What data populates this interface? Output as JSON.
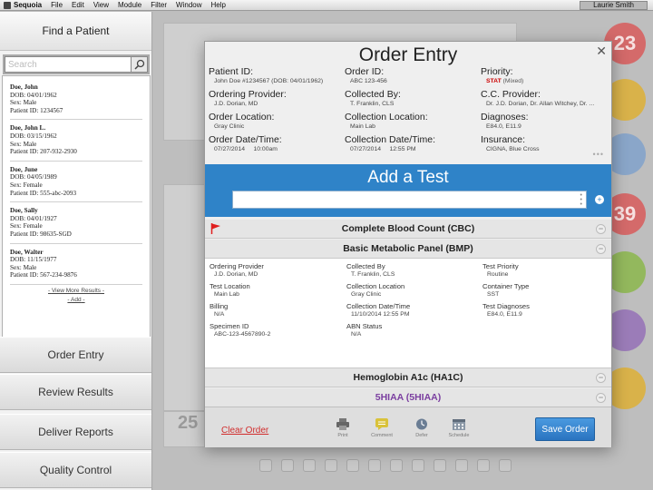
{
  "menubar": {
    "app_name": "Sequoia",
    "menus": [
      "File",
      "Edit",
      "View",
      "Module",
      "Filter",
      "Window",
      "Help"
    ],
    "user": "Laurie Smith"
  },
  "sidebar": {
    "title": "Find a Patient",
    "search_placeholder": "Search",
    "patients": [
      {
        "name": "Doe, John",
        "dob": "DOB: 04/01/1962",
        "sex": "Sex: Male",
        "pid": "Patient ID: 1234567"
      },
      {
        "name": "Doe, John L.",
        "dob": "DOB: 03/15/1962",
        "sex": "Sex: Male",
        "pid": "Patient ID: 207-932-2930"
      },
      {
        "name": "Doe, June",
        "dob": "DOB: 04/05/1989",
        "sex": "Sex: Female",
        "pid": "Patient ID: 555-abc-2093"
      },
      {
        "name": "Doe, Sally",
        "dob": "DOB: 04/01/1927",
        "sex": "Sex: Female",
        "pid": "Patient ID: 98635-SGD"
      },
      {
        "name": "Doe, Walter",
        "dob": "DOB: 11/15/1977",
        "sex": "Sex: Male",
        "pid": "Patient ID: 567-234-9876"
      }
    ],
    "view_more": "View More Results",
    "add": "Add",
    "nav": [
      "Order Entry",
      "Review Results",
      "Deliver Reports",
      "Quality Control"
    ]
  },
  "background": {
    "circle_numbers": [
      "23",
      "39",
      "25"
    ]
  },
  "modal": {
    "title": "Order Entry",
    "fields": [
      {
        "label": "Patient ID:",
        "value": "John Doe #1234567 (DOB: 04/01/1962)"
      },
      {
        "label": "Order ID:",
        "value": "ABC 123-456"
      },
      {
        "label": "Priority:",
        "value": "STAT",
        "value_extra": "(Mixed)"
      },
      {
        "label": "Ordering Provider:",
        "value": "J.D. Dorian, MD"
      },
      {
        "label": "Collected By:",
        "value": "T. Franklin, CLS"
      },
      {
        "label": "C.C. Provider:",
        "value": "Dr. J.D. Dorian, Dr. Allan Witchey, Dr. ..."
      },
      {
        "label": "Order Location:",
        "value": "Gray Clinic"
      },
      {
        "label": "Collection Location:",
        "value": "Main Lab"
      },
      {
        "label": "Diagnoses:",
        "value": "E84.0, E11.9"
      },
      {
        "label": "Order Date/Time:",
        "value": "07/27/2014     10:00am"
      },
      {
        "label": "Collection Date/Time:",
        "value": "07/27/2014     12:55 PM"
      },
      {
        "label": "Insurance:",
        "value": "CIGNA, Blue Cross"
      }
    ],
    "add_test_title": "Add a Test",
    "tests": [
      {
        "name": "Complete Blood Count (CBC)",
        "flagged": true
      },
      {
        "name": "Basic Metabolic Panel (BMP)",
        "flagged": false
      },
      {
        "name": "Hemoglobin A1c (HA1C)",
        "flagged": false
      },
      {
        "name": "5HIAA (5HIAA)",
        "flagged": false
      }
    ],
    "details": [
      {
        "label": "Ordering Provider",
        "value": "J.D. Dorian, MD"
      },
      {
        "label": "Collected By",
        "value": "T. Franklin, CLS"
      },
      {
        "label": "Test Priority",
        "value": "Routine"
      },
      {
        "label": "Test Location",
        "value": "Main Lab"
      },
      {
        "label": "Collection Location",
        "value": "Gray Clinic"
      },
      {
        "label": "Container Type",
        "value": "SST"
      },
      {
        "label": "Billing",
        "value": "N/A"
      },
      {
        "label": "Collection Date/Time",
        "value": "11/10/2014 12:55 PM"
      },
      {
        "label": "Test Diagnoses",
        "value": "E84.0, E11.9"
      },
      {
        "label": "Specimen ID",
        "value": "ABC-123-4567890-2"
      },
      {
        "label": "ABN Status",
        "value": "N/A"
      }
    ],
    "footer": {
      "clear": "Clear Order",
      "print": "Print",
      "comment": "Comment",
      "defer": "Defer",
      "schedule": "Schedule",
      "save": "Save Order"
    }
  },
  "colors": {
    "accent_blue": "#2f83c8",
    "clear_red": "#d12d2d",
    "stat_red": "#cc0000",
    "purple_test": "#7b3fa0",
    "flag_red": "#e02020"
  }
}
